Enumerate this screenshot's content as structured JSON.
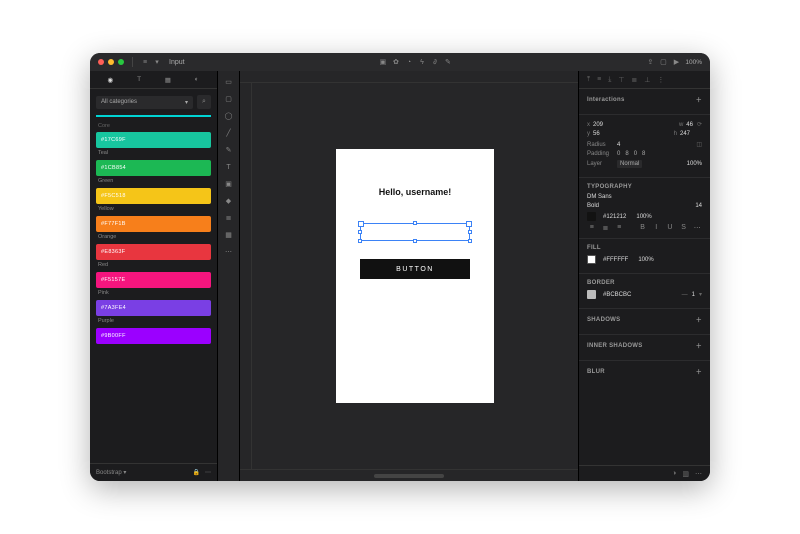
{
  "titlebar": {
    "doc_name": "Input",
    "zoom": "100%"
  },
  "left": {
    "category_label": "All categories",
    "colors": [
      {
        "hex": "#17C69F",
        "code": "#17C69F",
        "name": "Teal"
      },
      {
        "hex": "#1CB854",
        "code": "#1CB854",
        "name": "Green"
      },
      {
        "hex": "#F5C518",
        "code": "#F5C518",
        "name": "Yellow"
      },
      {
        "hex": "#F77F1B",
        "code": "#F77F1B",
        "name": "Orange"
      },
      {
        "hex": "#E8363F",
        "code": "#E8363F",
        "name": "Red"
      },
      {
        "hex": "#F5157E",
        "code": "#F5157E",
        "name": "Pink"
      },
      {
        "hex": "#7A3FE4",
        "code": "#7A3FE4",
        "name": "Purple"
      },
      {
        "hex": "#9B00FF",
        "code": "#9B00FF",
        "name": ""
      }
    ],
    "footer_label": "Bootstrap"
  },
  "artboard": {
    "heading": "Hello, username!",
    "button_label": "BUTTON"
  },
  "inspector": {
    "interactions_title": "Interactions",
    "x": "209",
    "w": "46",
    "y": "56",
    "h": "247",
    "radius_label": "Radius",
    "radius": "4",
    "padding_label": "Padding",
    "pad": [
      "0",
      "8",
      "0",
      "8"
    ],
    "layer_label": "Layer",
    "blend": "Normal",
    "opacity": "100%",
    "typography_title": "TYPOGRAPHY",
    "font": "DM Sans",
    "weight": "Bold",
    "size": "14",
    "text_color": "#121212",
    "text_opacity": "100%",
    "fill_title": "FILL",
    "fill_color": "#FFFFFF",
    "fill_opacity": "100%",
    "border_title": "BORDER",
    "border_color": "#BCBCBC",
    "border_width": "1",
    "shadows_title": "SHADOWS",
    "inner_shadows_title": "INNER SHADOWS",
    "blur_title": "BLUR"
  }
}
